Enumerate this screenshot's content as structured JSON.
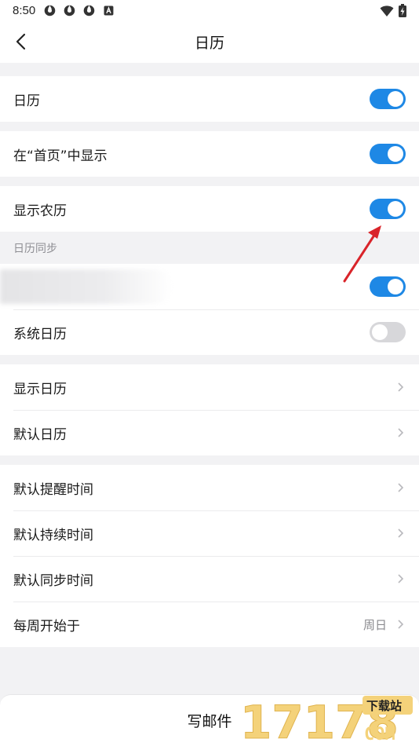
{
  "status_bar": {
    "time": "8:50",
    "icons": [
      "app-notification-icon",
      "app-notification-icon",
      "app-notification-icon",
      "a-badge-icon"
    ],
    "right_icons": [
      "wifi-icon",
      "battery-charging-icon"
    ]
  },
  "header": {
    "title": "日历",
    "back_icon": "chevron-left-icon"
  },
  "settings": {
    "calendar": {
      "label": "日历",
      "enabled": true
    },
    "show_on_home": {
      "label": "在“首页”中显示",
      "enabled": true
    },
    "lunar": {
      "label": "显示农历",
      "enabled": true
    }
  },
  "sync_section": {
    "title": "日历同步",
    "account": {
      "enabled": true
    },
    "system_calendar": {
      "label": "系统日历",
      "enabled": false
    }
  },
  "display": {
    "show_calendar": {
      "label": "显示日历"
    },
    "default_calendar": {
      "label": "默认日历"
    }
  },
  "defaults": {
    "reminder_time": {
      "label": "默认提醒时间"
    },
    "duration": {
      "label": "默认持续时间"
    },
    "sync_time": {
      "label": "默认同步时间"
    },
    "week_start": {
      "label": "每周开始于",
      "value": "周日"
    }
  },
  "compose": {
    "label": "写邮件"
  },
  "watermark": {
    "text": "17178",
    "badge": "下载站",
    "suffix": "COM"
  },
  "colors": {
    "accent": "#1e88e5",
    "toggle_off": "#d7d7da",
    "annotation_arrow": "#d9242a",
    "background": "#f2f2f4"
  }
}
